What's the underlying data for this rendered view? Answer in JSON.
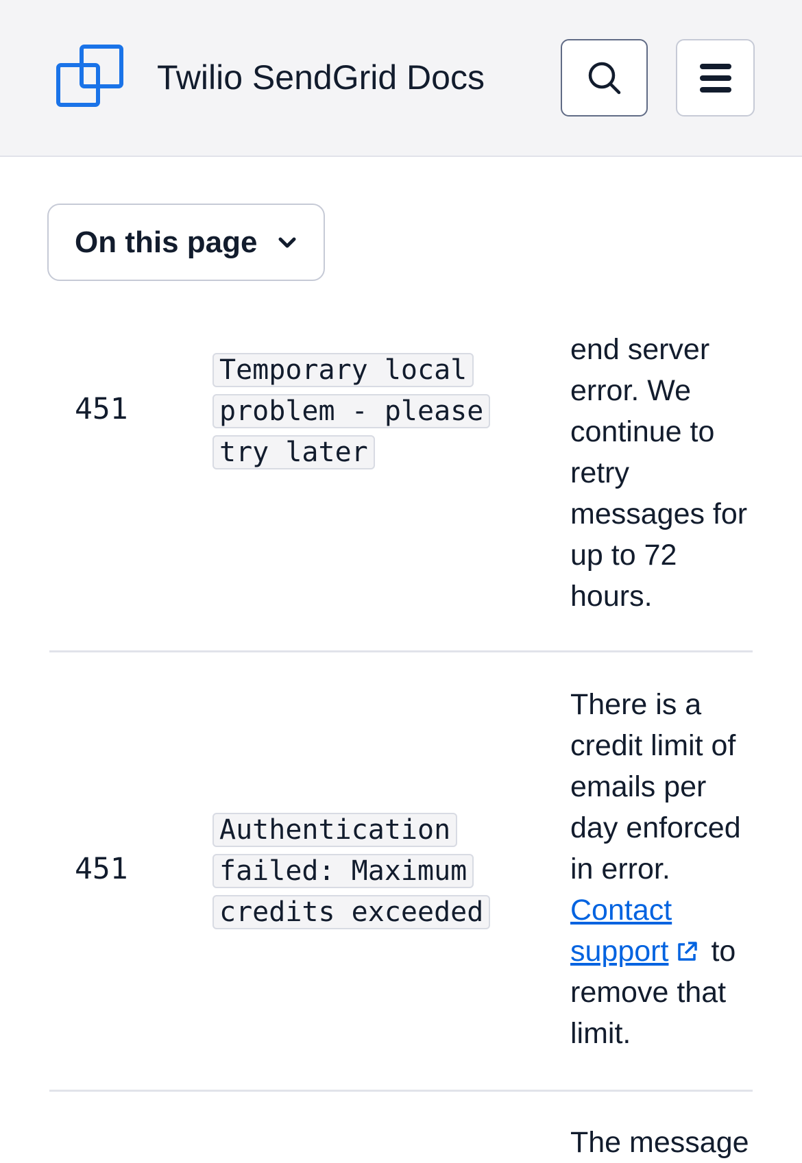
{
  "header": {
    "title": "Twilio SendGrid Docs",
    "logo_icon": "sendgrid-logo-icon",
    "search_icon": "search-icon",
    "menu_icon": "hamburger-menu-icon",
    "brand_color": "#1a73e8"
  },
  "toc": {
    "label": "On this page",
    "chevron_icon": "chevron-down-icon"
  },
  "rows": [
    {
      "code": "451",
      "message": "Temporary local problem - please try later",
      "description": "end server error. We continue to retry messages for up to 72 hours."
    },
    {
      "code": "451",
      "message": "Authentication failed: Maximum credits exceeded",
      "description_before": "There is a credit limit of emails per day enforced in error.",
      "link_text": "Contact support",
      "link_icon": "external-link-icon",
      "description_after": "to remove that limit."
    },
    {
      "description_partial": "The message"
    }
  ]
}
